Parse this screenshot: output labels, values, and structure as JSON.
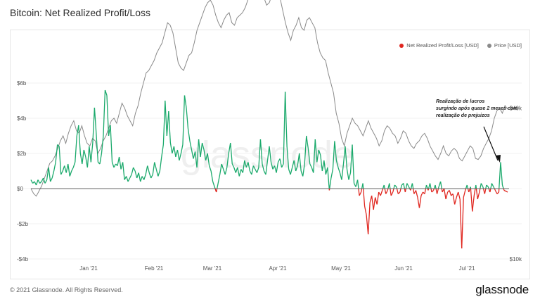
{
  "title": "Bitcoin: Net Realized Profit/Loss",
  "legend": {
    "net_label": "Net Realized Profit/Loss [USD]",
    "price_label": "Price [USD]"
  },
  "annotation": {
    "line1": "Realização de lucros",
    "line2": "surgindo após quase 2 meses com",
    "line3": "realização de prejuizos"
  },
  "watermark": "glassnode",
  "footer": "© 2021 Glassnode. All Rights Reserved.",
  "logo": "glassnode",
  "colors": {
    "profit": "#1aa96b",
    "loss": "#e0261f",
    "price": "#8a8a8a",
    "grid": "#f0f0f0",
    "zero_line": "#666666"
  },
  "chart_data": {
    "type": "line",
    "x_tick_labels": [
      "Jan '21",
      "Feb '21",
      "Mar '21",
      "Apr '21",
      "May '21",
      "Jun '21",
      "Jul '21"
    ],
    "y_left_ticks": [
      {
        "value": 6,
        "label": "$6b"
      },
      {
        "value": 4,
        "label": "$4b"
      },
      {
        "value": 2,
        "label": "$2b"
      },
      {
        "value": 0,
        "label": "$0"
      },
      {
        "value": -2,
        "label": "-$2b"
      },
      {
        "value": -4,
        "label": "-$4b"
      }
    ],
    "y_right_ticks": [
      {
        "value": 40000,
        "label": "$40k"
      },
      {
        "value": 10000,
        "label": "$10k"
      }
    ],
    "ylim_left": [
      -4,
      6
    ],
    "ylim_right": [
      10000,
      45000
    ],
    "grid": true,
    "legend_position": "top-right",
    "series": [
      {
        "name": "Net Realized Profit/Loss [USD]",
        "axis": "left",
        "values": [
          0.5,
          0.3,
          0.4,
          0.2,
          0.5,
          0.3,
          0.4,
          0.6,
          0.3,
          0.5,
          1.2,
          0.4,
          0.6,
          1.0,
          1.5,
          2.5,
          2.4,
          0.8,
          1.0,
          1.3,
          0.9,
          1.4,
          0.7,
          1.0,
          1.2,
          1.5,
          3.0,
          3.6,
          2.0,
          1.4,
          2.2,
          1.8,
          1.2,
          2.4,
          1.5,
          2.6,
          4.6,
          3.1,
          1.5,
          1.4,
          2.0,
          3.0,
          5.6,
          5.3,
          3.0,
          3.6,
          1.5,
          1.2,
          1.4,
          1.3,
          1.8,
          1.1,
          1.5,
          0.5,
          0.7,
          0.4,
          0.6,
          0.8,
          1.2,
          1.0,
          0.6,
          0.9,
          0.4,
          0.7,
          0.5,
          0.8,
          1.3,
          0.9,
          0.6,
          0.8,
          1.5,
          1.1,
          0.7,
          1.0,
          1.8,
          2.5,
          5.0,
          3.0,
          4.4,
          2.6,
          2.0,
          2.4,
          1.8,
          2.2,
          1.6,
          2.0,
          2.5,
          5.3,
          4.6,
          3.4,
          2.7,
          2.2,
          1.7,
          2.1,
          1.2,
          2.8,
          1.8,
          2.6,
          2.2,
          1.6,
          2.0,
          1.3,
          1.0,
          0.4,
          0.1,
          -0.2,
          0.3,
          0.8,
          1.4,
          1.1,
          0.8,
          1.2,
          2.0,
          2.6,
          1.4,
          1.2,
          0.9,
          1.2,
          0.7,
          1.1,
          0.9,
          1.6,
          1.2,
          1.5,
          1.0,
          0.8,
          1.3,
          1.1,
          0.9,
          1.2,
          2.8,
          1.4,
          1.0,
          0.8,
          1.6,
          2.4,
          1.5,
          1.1,
          1.3,
          0.9,
          1.5,
          1.7,
          1.2,
          1.4,
          5.5,
          2.4,
          1.1,
          0.8,
          1.2,
          1.6,
          1.0,
          1.3,
          2.0,
          1.0,
          0.7,
          1.4,
          3.0,
          2.3,
          1.4,
          1.2,
          0.9,
          2.8,
          1.5,
          2.2,
          1.9,
          1.0,
          1.6,
          0.8,
          1.2,
          -0.1,
          0.6,
          1.1,
          2.7,
          1.6,
          1.2,
          0.9,
          0.5,
          1.4,
          2.4,
          1.1,
          0.5,
          0.9,
          2.5,
          0.3,
          0.1,
          0.5,
          -0.4,
          -0.2,
          0.3,
          -1.0,
          -1.5,
          -2.6,
          -0.8,
          -0.4,
          -1.2,
          -0.5,
          -0.9,
          -0.2,
          -0.4,
          -0.1,
          0.2,
          -0.3,
          -0.1,
          0.3,
          -0.4,
          -0.2,
          0.2,
          0.1,
          -0.3,
          -0.2,
          0.2,
          0.3,
          -0.2,
          0.3,
          0.1,
          -0.1,
          0.3,
          -0.3,
          -0.1,
          -0.5,
          -1.1,
          -0.4,
          -0.2,
          -0.3,
          0.2,
          -0.1,
          0.3,
          -0.2,
          -0.1,
          0.2,
          -0.3,
          0.1,
          0.4,
          -0.2,
          0.0,
          -0.6,
          -0.2,
          -0.1,
          -0.4,
          -0.3,
          -0.9,
          -0.5,
          -0.2,
          -0.6,
          -3.4,
          -0.5,
          -0.1,
          0.2,
          -0.2,
          0.1,
          -1.3,
          -0.4,
          0.2,
          -0.6,
          -0.2,
          0.3,
          0.1,
          -0.3,
          0.2,
          0.1,
          -0.2,
          0.3,
          0.1,
          -0.1,
          -0.3,
          -0.2,
          1.5,
          0.2,
          -0.1,
          -0.15,
          -0.2
        ]
      },
      {
        "name": "Price [USD]",
        "axis": "right",
        "values": [
          24000,
          23000,
          22500,
          23500,
          24500,
          26000,
          27500,
          29000,
          29500,
          30500,
          32000,
          33500,
          34500,
          33000,
          35000,
          36500,
          37500,
          35500,
          35000,
          36500,
          34500,
          33000,
          32500,
          34000,
          33500,
          31000,
          32000,
          33500,
          34500,
          36000,
          37500,
          38000,
          37000,
          39000,
          41000,
          40000,
          38500,
          37500,
          36500,
          39000,
          40500,
          43000,
          45000,
          47000,
          47500,
          48500,
          49500,
          51000,
          52000,
          53000,
          55000,
          57000,
          56500,
          55000,
          52000,
          49000,
          48000,
          47500,
          49000,
          50500,
          51000,
          53000,
          55500,
          57000,
          58500,
          60000,
          61000,
          61500,
          60500,
          58500,
          57000,
          56000,
          57500,
          58500,
          59000,
          57000,
          56500,
          58000,
          58500,
          59000,
          60000,
          61500,
          62500,
          63000,
          63500,
          64000,
          63000,
          62000,
          60500,
          61000,
          62500,
          63500,
          64500,
          62000,
          59500,
          57000,
          55000,
          53500,
          55500,
          56500,
          58000,
          56000,
          55500,
          57500,
          58000,
          57000,
          56000,
          53000,
          51000,
          50000,
          49500,
          47000,
          45000,
          43000,
          39000,
          37000,
          34000,
          32500,
          35000,
          36500,
          38000,
          37000,
          36500,
          35500,
          34500,
          36000,
          37500,
          36000,
          35000,
          34000,
          32500,
          33500,
          35500,
          36500,
          36000,
          35000,
          34500,
          33000,
          34000,
          35500,
          35000,
          33500,
          32500,
          32000,
          33000,
          33500,
          34500,
          35000,
          34000,
          32500,
          31500,
          30500,
          29800,
          31000,
          32500,
          31000,
          30500,
          31500,
          32000,
          31500,
          30000,
          29500,
          30500,
          31500,
          32500,
          32000,
          30000,
          29800,
          30500,
          32000,
          33000,
          34000,
          35500,
          38000,
          39500,
          40000,
          39000,
          40500,
          39800
        ]
      }
    ]
  }
}
